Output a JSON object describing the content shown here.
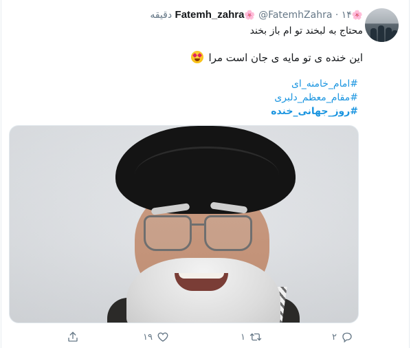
{
  "tweet": {
    "display_name": "Fatemh_zahra",
    "name_decor": "🌸",
    "handle": "@FatemhZahra",
    "separator": "·",
    "time": "۱۴ دقیقه",
    "line1": "محتاج به لبخند تو ام باز بخند",
    "line2": "این خنده ی تو مایه ی جان است مرا",
    "emoji": "heart-eyes-emoji",
    "hashtags": [
      "#امام_خامنه_ای",
      "#مقام_معظم_دلبری",
      "#روز_جهانی_خنده"
    ],
    "media": "photo"
  },
  "actions": {
    "reply_count": "۲",
    "retweet_count": "۱",
    "like_count": "۱۹",
    "icons": [
      "reply-icon",
      "retweet-icon",
      "like-icon",
      "share-icon"
    ]
  },
  "colors": {
    "link": "#1b95e0",
    "muted": "#657786",
    "text": "#14171a"
  }
}
